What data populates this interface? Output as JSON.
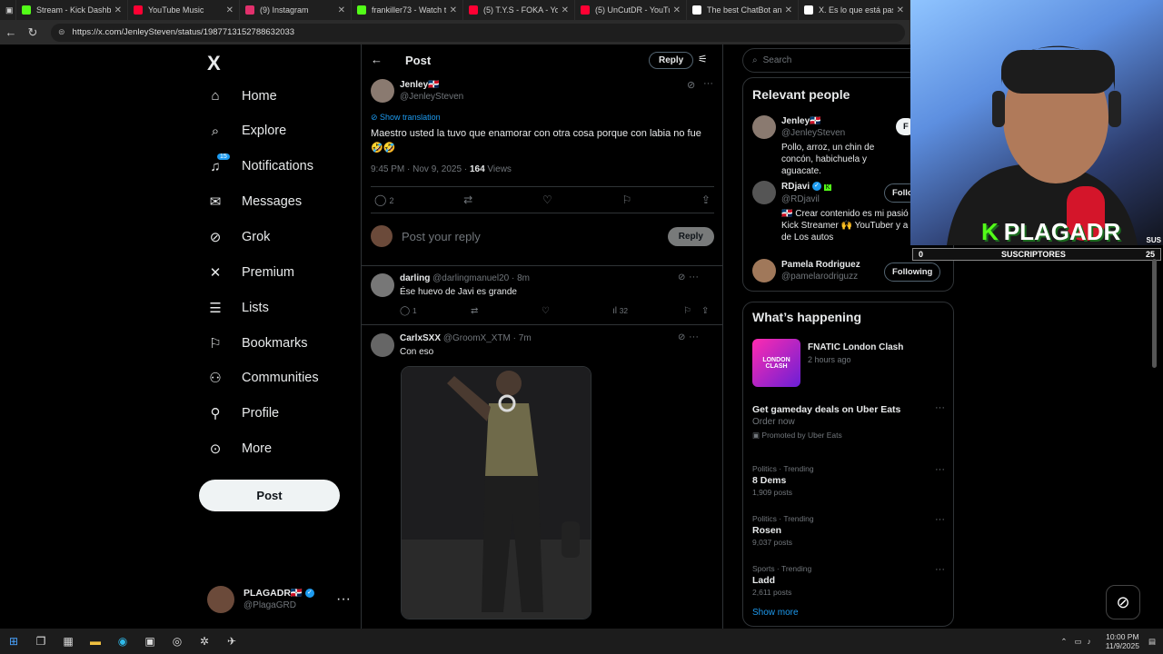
{
  "browser": {
    "tabs": [
      {
        "label": "Stream - Kick Dashboard",
        "color": "#53fc18"
      },
      {
        "label": "YouTube Music",
        "color": "#ff0033"
      },
      {
        "label": "(9) Instagram",
        "color": "#e1306c"
      },
      {
        "label": "frankiller73 - Watch the",
        "color": "#53fc18"
      },
      {
        "label": "(5) T.Y.S - FOKA - YouTube",
        "color": "#ff0033"
      },
      {
        "label": "(5) UnCutDR - YouTube",
        "color": "#ff0033"
      },
      {
        "label": "The best ChatBot and Y",
        "color": "#ffffff"
      },
      {
        "label": "X. Es lo que está pasan",
        "color": "#ffffff"
      }
    ],
    "url": "https://x.com/JenleySteven/status/1987713152788632033"
  },
  "nav": {
    "logo": "X",
    "items": [
      {
        "label": "Home",
        "icon": "home-icon",
        "glyph": "⌂"
      },
      {
        "label": "Explore",
        "icon": "search-icon",
        "glyph": "⌕"
      },
      {
        "label": "Notifications",
        "icon": "bell-icon",
        "glyph": "♫",
        "badge": "15"
      },
      {
        "label": "Messages",
        "icon": "mail-icon",
        "glyph": "✉"
      },
      {
        "label": "Grok",
        "icon": "grok-icon",
        "glyph": "⊘"
      },
      {
        "label": "Premium",
        "icon": "x-icon",
        "glyph": "✕"
      },
      {
        "label": "Lists",
        "icon": "list-icon",
        "glyph": "☰"
      },
      {
        "label": "Bookmarks",
        "icon": "bookmark-icon",
        "glyph": "⚐"
      },
      {
        "label": "Communities",
        "icon": "people-icon",
        "glyph": "⚇"
      },
      {
        "label": "Profile",
        "icon": "person-icon",
        "glyph": "⚲"
      },
      {
        "label": "More",
        "icon": "more-circle-icon",
        "glyph": "⊙"
      }
    ],
    "post_button": "Post",
    "account": {
      "name": "PLAGADR🇩🇴",
      "handle": "@PlagaGRD"
    }
  },
  "main": {
    "title": "Post",
    "reply_button": "Reply",
    "author": {
      "name": "Jenley🇩🇴",
      "handle": "@JenleySteven"
    },
    "show_translation": "Show translation",
    "text": "Maestro usted la tuvo que enamorar con otra cosa porque con labia no fue 🤣🤣",
    "time": "9:45 PM · Nov 9, 2025 · ",
    "views_count": "164",
    "views_label": " Views",
    "replies_count": "2",
    "compose_placeholder": "Post your reply",
    "compose_button": "Reply",
    "replies": [
      {
        "name": "darling",
        "meta": "@darlingmanuel20 · 8m",
        "text": "Ése huevo de Javi es grande",
        "replies": "1",
        "views": "32"
      },
      {
        "name": "CarlxSXX",
        "meta": "@GroomX_XTM · 7m",
        "text": "Con eso"
      }
    ]
  },
  "sidebar": {
    "search_placeholder": "Search",
    "relevant_title": "Relevant people",
    "people": [
      {
        "name": "Jenley🇩🇴",
        "handle": "@JenleySteven",
        "bio": "Pollo, arroz, un chin de concón, habichuela y aguacate.",
        "button": "F"
      },
      {
        "name": "RDjavi",
        "handle": "@RDjavil",
        "bio": "🇩🇴 Crear contenido es mi pasió Kick Streamer 🙌 YouTuber y a de Los autos",
        "button": "Follo"
      },
      {
        "name": "Pamela Rodriguez",
        "handle": "@pamelarodriguzz",
        "bio": "",
        "button": "Following"
      }
    ],
    "happening_title": "What’s happening",
    "event": {
      "name": "FNATIC London Clash",
      "time": "2 hours ago",
      "image_text": "LONDON CLASH"
    },
    "promo": {
      "name": "Get gameday deals on Uber Eats",
      "sub": "Order now",
      "promoted": "Promoted by Uber Eats"
    },
    "trends": [
      {
        "cat": "Politics · Trending",
        "name": "8 Dems",
        "posts": "1,909 posts"
      },
      {
        "cat": "Politics · Trending",
        "name": "Rosen",
        "posts": "9,037 posts"
      },
      {
        "cat": "Sports · Trending",
        "name": "Ladd",
        "posts": "2,611 posts"
      }
    ],
    "show_more": "Show more"
  },
  "stream_overlay": {
    "name": "PLAGADR",
    "logo_letter": "K",
    "label": "SUSCRIPTORES",
    "left_num": "0",
    "right_num": "25",
    "corner": "SUS"
  },
  "taskbar": {
    "time": "10:00 PM",
    "date": "11/9/2025"
  }
}
